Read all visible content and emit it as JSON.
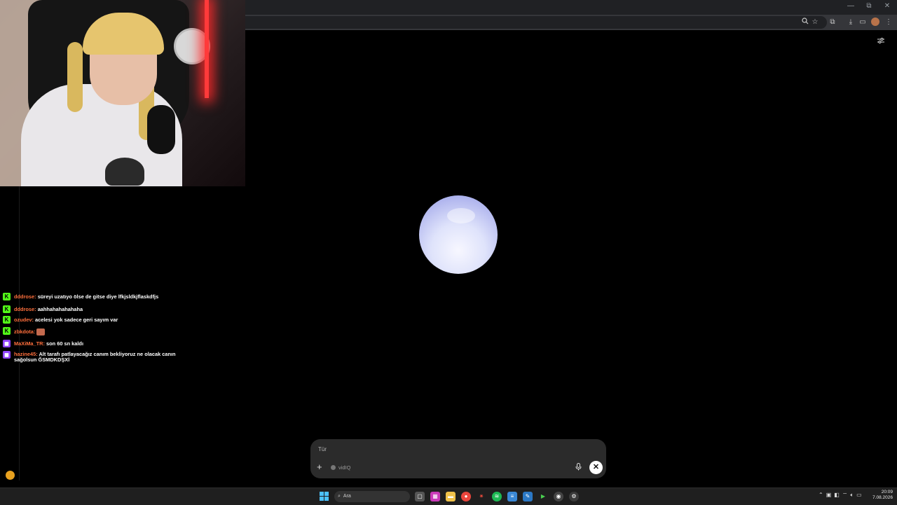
{
  "browser": {
    "window_controls": [
      "—",
      "⧉",
      "✕"
    ],
    "toolbar_icons": [
      "zoom-icon",
      "star-icon",
      "extensions-icon",
      "download-icon",
      "cast-icon",
      "profile-avatar",
      "menu-icon"
    ]
  },
  "chat": {
    "messages": [
      {
        "platform": "kick",
        "user": "dddrose:",
        "text": "süreyi uzatıyo ölse de gitse diye lfkjsldkjflaskdfjs"
      },
      {
        "platform": "kick",
        "user": "dddrose:",
        "text": "aahhahahahahaha"
      },
      {
        "platform": "kick",
        "user": "ozudev:",
        "text": "acelesi yok sadece geri sayım var"
      },
      {
        "platform": "kick",
        "user": "zbkdota:",
        "text": ""
      },
      {
        "platform": "twitch",
        "user": "MaXiMa_TR:",
        "text": "son 60 sn kaldı"
      },
      {
        "platform": "twitch",
        "user": "hazine45:",
        "text": "Alt tarafı patlayacağız canım bekliyoruz ne olacak canın sağolsun ĞSMDKDŞXİ"
      }
    ]
  },
  "composer": {
    "placeholder": "Tür",
    "model_label": "vidIQ",
    "plus_label": "+",
    "close_label": "✕"
  },
  "taskbar": {
    "search_placeholder": "Ara",
    "time": "20:09",
    "date": "7.08.2026"
  },
  "colors": {
    "kick_badge": "#53fc18",
    "twitch_badge": "#9146ff",
    "username": "#ff6f3c",
    "orb_light": "#f7f7ff",
    "orb_dark": "#8e96e6"
  }
}
